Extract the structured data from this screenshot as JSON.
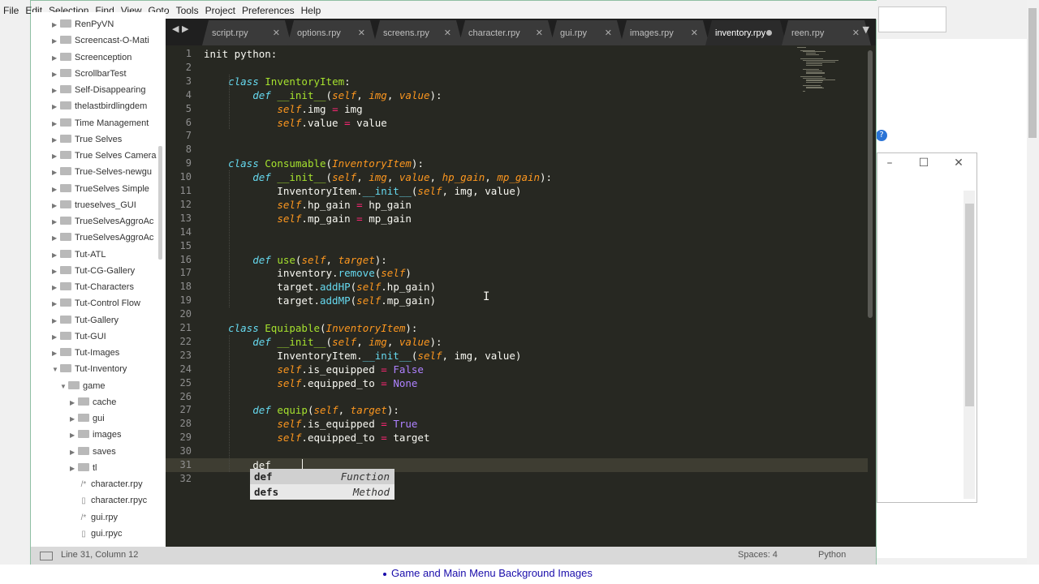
{
  "menu": [
    "File",
    "Edit",
    "Selection",
    "Find",
    "View",
    "Goto",
    "Tools",
    "Project",
    "Preferences",
    "Help"
  ],
  "sidebar": {
    "items": [
      {
        "label": "RenPyVN",
        "type": "folder",
        "depth": 0,
        "open": false
      },
      {
        "label": "Screencast-O-Mati",
        "type": "folder",
        "depth": 0,
        "open": false
      },
      {
        "label": "Screenception",
        "type": "folder",
        "depth": 0,
        "open": false
      },
      {
        "label": "ScrollbarTest",
        "type": "folder",
        "depth": 0,
        "open": false
      },
      {
        "label": "Self-Disappearing",
        "type": "folder",
        "depth": 0,
        "open": false
      },
      {
        "label": "thelastbirdlingdem",
        "type": "folder",
        "depth": 0,
        "open": false
      },
      {
        "label": "Time Management",
        "type": "folder",
        "depth": 0,
        "open": false
      },
      {
        "label": "True Selves",
        "type": "folder",
        "depth": 0,
        "open": false
      },
      {
        "label": "True Selves Camera",
        "type": "folder",
        "depth": 0,
        "open": false
      },
      {
        "label": "True-Selves-newgu",
        "type": "folder",
        "depth": 0,
        "open": false
      },
      {
        "label": "TrueSelves Simple",
        "type": "folder",
        "depth": 0,
        "open": false
      },
      {
        "label": "trueselves_GUI",
        "type": "folder",
        "depth": 0,
        "open": false
      },
      {
        "label": "TrueSelvesAggroAc",
        "type": "folder",
        "depth": 0,
        "open": false
      },
      {
        "label": "TrueSelvesAggroAc",
        "type": "folder",
        "depth": 0,
        "open": false
      },
      {
        "label": "Tut-ATL",
        "type": "folder",
        "depth": 0,
        "open": false
      },
      {
        "label": "Tut-CG-Gallery",
        "type": "folder",
        "depth": 0,
        "open": false
      },
      {
        "label": "Tut-Characters",
        "type": "folder",
        "depth": 0,
        "open": false
      },
      {
        "label": "Tut-Control Flow",
        "type": "folder",
        "depth": 0,
        "open": false
      },
      {
        "label": "Tut-Gallery",
        "type": "folder",
        "depth": 0,
        "open": false
      },
      {
        "label": "Tut-GUI",
        "type": "folder",
        "depth": 0,
        "open": false
      },
      {
        "label": "Tut-Images",
        "type": "folder",
        "depth": 0,
        "open": false
      },
      {
        "label": "Tut-Inventory",
        "type": "folder",
        "depth": 0,
        "open": true
      },
      {
        "label": "game",
        "type": "folder",
        "depth": 1,
        "open": true
      },
      {
        "label": "cache",
        "type": "folder",
        "depth": 2,
        "open": false
      },
      {
        "label": "gui",
        "type": "folder",
        "depth": 2,
        "open": false
      },
      {
        "label": "images",
        "type": "folder",
        "depth": 2,
        "open": false
      },
      {
        "label": "saves",
        "type": "folder",
        "depth": 2,
        "open": false
      },
      {
        "label": "tl",
        "type": "folder",
        "depth": 2,
        "open": false
      },
      {
        "label": "character.rpy",
        "type": "script",
        "depth": 2
      },
      {
        "label": "character.rpyc",
        "type": "file",
        "depth": 2
      },
      {
        "label": "gui.rpy",
        "type": "script",
        "depth": 2
      },
      {
        "label": "gui.rpyc",
        "type": "file",
        "depth": 2
      }
    ]
  },
  "tabs": [
    {
      "label": "script.rpy",
      "active": false,
      "dirty": false
    },
    {
      "label": "options.rpy",
      "active": false,
      "dirty": false
    },
    {
      "label": "screens.rpy",
      "active": false,
      "dirty": false
    },
    {
      "label": "character.rpy",
      "active": false,
      "dirty": false
    },
    {
      "label": "gui.rpy",
      "active": false,
      "dirty": false
    },
    {
      "label": "images.rpy",
      "active": false,
      "dirty": false
    },
    {
      "label": "inventory.rpy",
      "active": true,
      "dirty": true
    },
    {
      "label": "reen.rpy",
      "active": false,
      "dirty": false
    }
  ],
  "code_lines": [
    "init python:",
    "",
    "    class InventoryItem:",
    "        def __init__(self, img, value):",
    "            self.img = img",
    "            self.value = value",
    "",
    "",
    "    class Consumable(InventoryItem):",
    "        def __init__(self, img, value, hp_gain, mp_gain):",
    "            InventoryItem.__init__(self, img, value)",
    "            self.hp_gain = hp_gain",
    "            self.mp_gain = mp_gain",
    "",
    "",
    "        def use(self, target):",
    "            inventory.remove(self)",
    "            target.addHP(self.hp_gain)",
    "            target.addMP(self.mp_gain)",
    "",
    "    class Equipable(InventoryItem):",
    "        def __init__(self, img, value):",
    "            InventoryItem.__init__(self, img, value)",
    "            self.is_equipped = False",
    "            self.equipped_to = None",
    "",
    "        def equip(self, target):",
    "            self.is_equipped = True",
    "            self.equipped_to = target",
    "",
    "        def",
    ""
  ],
  "current_line": 31,
  "autocomplete": [
    {
      "word": "def",
      "type": "Function"
    },
    {
      "word": "defs",
      "type": "Method"
    }
  ],
  "status": {
    "position": "Line 31, Column 12",
    "indent": "Spaces: 4",
    "syntax": "Python"
  },
  "background": {
    "link_text": "Game and Main Menu Background Images",
    "help_glyph": "?"
  },
  "colors": {
    "keyword": "#66d9ef",
    "class_name": "#a6e22e",
    "self": "#fd971f",
    "operator": "#f92672",
    "constant": "#ae81ff",
    "editor_bg": "#272822"
  }
}
